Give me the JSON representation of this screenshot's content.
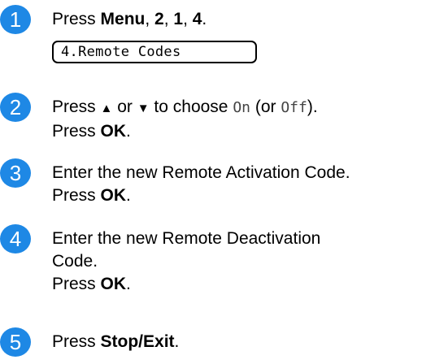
{
  "steps": [
    {
      "number": "1",
      "text_press": "Press ",
      "keys": [
        "Menu",
        "2",
        "1",
        "4"
      ],
      "lcd_display": "4.Remote Codes"
    },
    {
      "number": "2",
      "text_press": "Press ",
      "up_arrow": "▲",
      "or_1": " or ",
      "down_arrow": "▼",
      "to_choose": " to choose ",
      "option_on": "On",
      "or_paren": " (or ",
      "option_off": "Off",
      "close_paren": ").",
      "line2_press": "Press ",
      "line2_key": "OK",
      "line2_end": "."
    },
    {
      "number": "3",
      "text": "Enter the new Remote Activation Code.",
      "line2_press": "Press ",
      "line2_key": "OK",
      "line2_end": "."
    },
    {
      "number": "4",
      "text_line1": "Enter the new Remote Deactivation",
      "text_line2": "Code.",
      "line3_press": "Press ",
      "line3_key": "OK",
      "line3_end": "."
    },
    {
      "number": "5",
      "text_press": "Press ",
      "key": "Stop/Exit",
      "end": "."
    }
  ],
  "colors": {
    "step_badge": "#1e88e5",
    "text": "#000000"
  }
}
